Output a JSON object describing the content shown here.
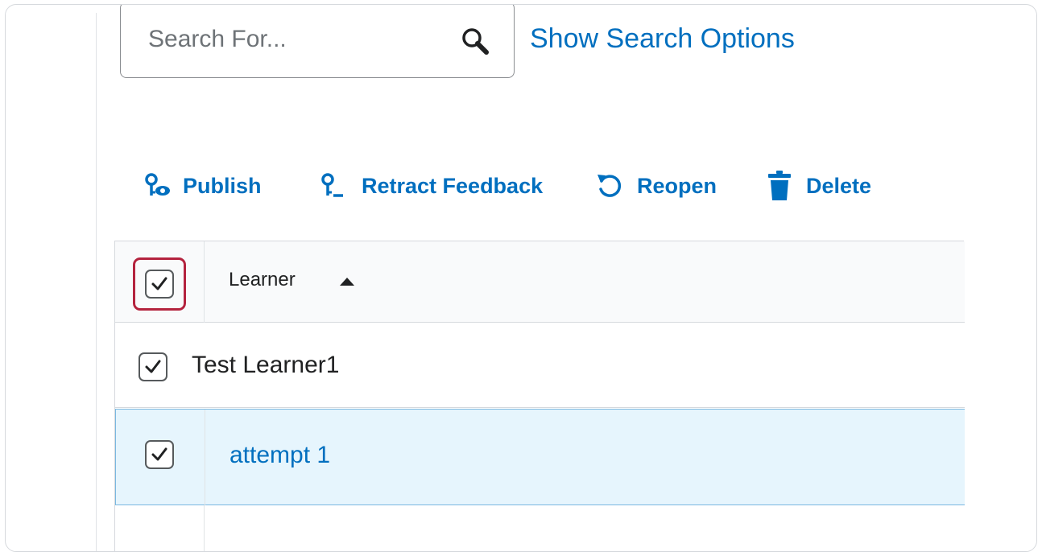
{
  "search": {
    "placeholder": "Search For...",
    "options_link": "Show Search Options"
  },
  "toolbar": {
    "buttons": [
      {
        "label": "Publish",
        "icon": "publish-icon"
      },
      {
        "label": "Retract Feedback",
        "icon": "retract-feedback-icon"
      },
      {
        "label": "Reopen",
        "icon": "reopen-icon"
      },
      {
        "label": "Delete",
        "icon": "trash-icon"
      }
    ]
  },
  "table": {
    "header": {
      "column": "Learner",
      "sort": "ascending",
      "select_all_checked": true
    },
    "rows": [
      {
        "name": "Test Learner1",
        "checked": true
      },
      {
        "name": "attempt 1",
        "checked": true,
        "selected": true
      }
    ]
  },
  "colors": {
    "link": "#006fbf",
    "focus_ring": "#b4233e",
    "selected_row": "#e6f5fd"
  }
}
